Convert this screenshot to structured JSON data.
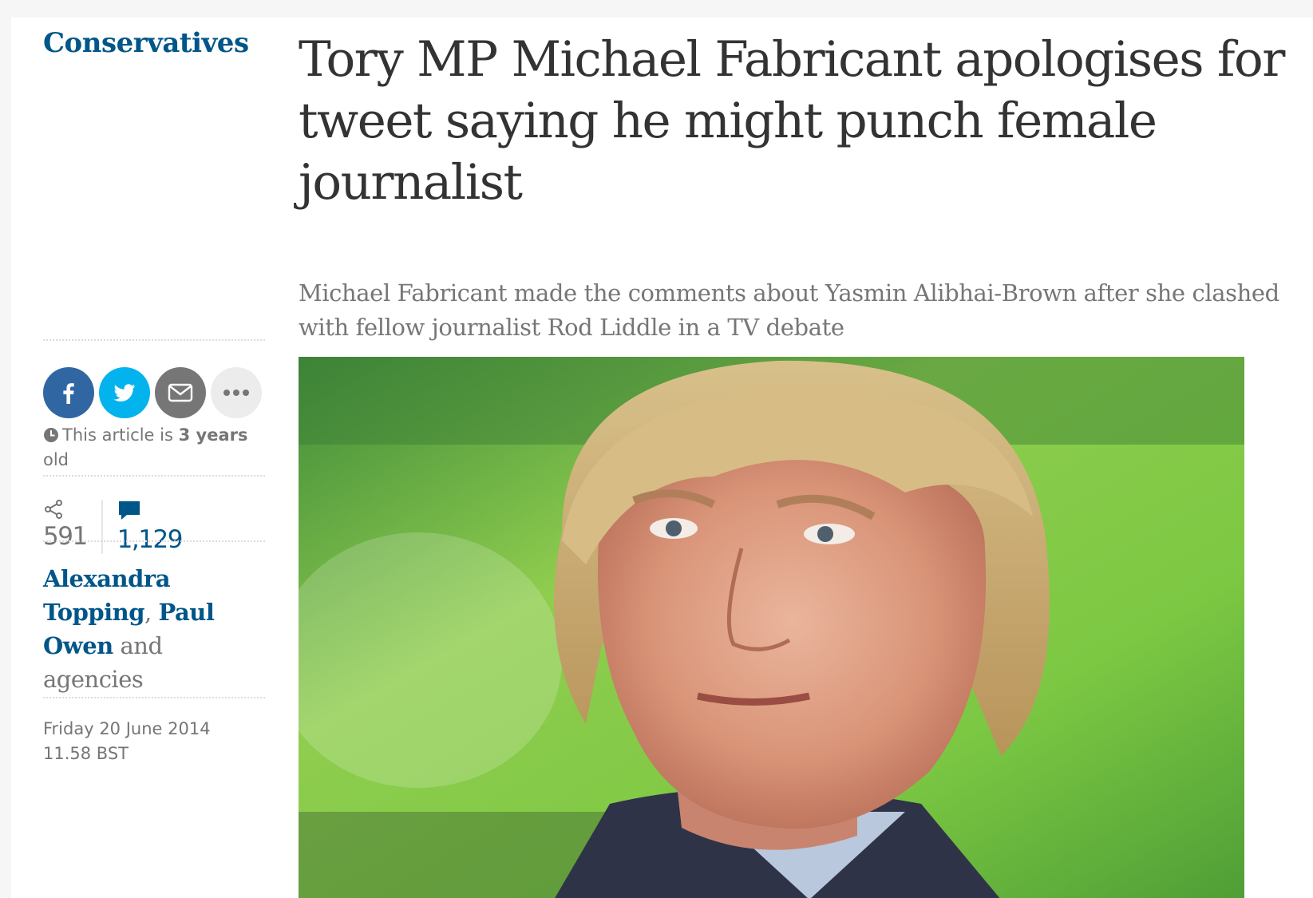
{
  "section": {
    "label": "Conservatives"
  },
  "article": {
    "headline": "Tory MP Michael Fabricant apologises for tweet saying he might punch female journalist",
    "standfirst": "Michael Fabricant made the comments about Yasmin Alibhai-Brown after she clashed with fellow journalist Rod Liddle in a TV debate"
  },
  "share": {
    "buttons": [
      {
        "icon": "facebook-icon",
        "color": "#3067a3"
      },
      {
        "icon": "twitter-icon",
        "color": "#03b3ee"
      },
      {
        "icon": "email-icon",
        "color": "#767676"
      },
      {
        "icon": "more-icon",
        "color": "#ececec"
      }
    ]
  },
  "age_notice": {
    "prefix": "This article is",
    "age": "3 years",
    "suffix": "old"
  },
  "counts": {
    "shares": "591",
    "comments": "1,129"
  },
  "byline": {
    "author1": "Alexandra Topping",
    "separator": ",",
    "author2": "Paul Owen",
    "conjunction": "and",
    "agencies": "agencies"
  },
  "dateline": {
    "date": "Friday 20 June 2014",
    "time": "11.58 BST"
  },
  "colors": {
    "accent": "#005689",
    "headline": "#333333",
    "muted": "#767676"
  }
}
